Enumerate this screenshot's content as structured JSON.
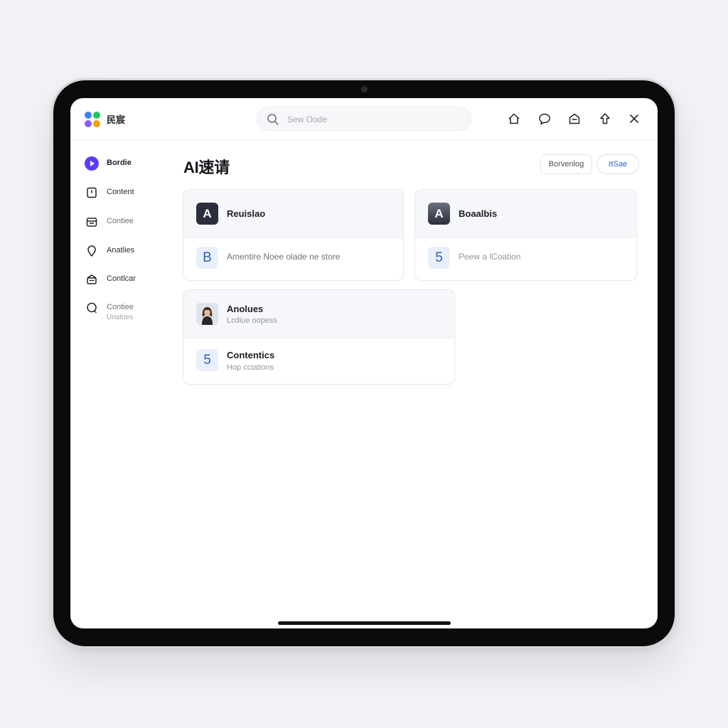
{
  "app": {
    "name": "民宸",
    "logo_colors": [
      "#3b82f6",
      "#22c55e",
      "#f59e0b",
      "#8b5cf6"
    ]
  },
  "search": {
    "placeholder": "Sew Oode"
  },
  "top_icons": [
    "home-outline-icon",
    "chat-bubble-icon",
    "inbox-icon",
    "upload-icon",
    "close-icon"
  ],
  "sidebar": {
    "items": [
      {
        "label": "Bordie",
        "icon": "play-circle-icon",
        "active": true
      },
      {
        "label": "Content",
        "icon": "document-icon"
      },
      {
        "label": "Contiee",
        "icon": "archive-box-icon"
      },
      {
        "label": "Anatlies",
        "icon": "location-pin-icon"
      },
      {
        "label": "Contlcar",
        "icon": "tray-icon"
      },
      {
        "label": "Contiee",
        "sublabel": "Unatries",
        "icon": "chat-circle-icon"
      }
    ]
  },
  "main": {
    "title": "AI速请",
    "buttons": {
      "secondary": "Borvenlog",
      "primary": "ሸSae"
    },
    "cards": [
      {
        "header": {
          "badge": "A",
          "title": "Reuislao"
        },
        "row": {
          "badge": "B",
          "text": "Amentire Noee olade ne store"
        }
      },
      {
        "header": {
          "badge": "A",
          "title": "Boaalbis"
        },
        "row": {
          "badge": "5",
          "text": "Peew a lCoation"
        }
      },
      {
        "header": {
          "title": "Anolues",
          "subtitle": "Lcdiue oopess",
          "avatar": "person-avatar"
        },
        "row": {
          "badge": "5",
          "title": "Contentics",
          "subtitle": "Hop cciations"
        }
      }
    ]
  },
  "colors": {
    "accent": "#5b3df5",
    "link_blue": "#2a5fc4",
    "badge_dark": "#2a2f3c"
  }
}
